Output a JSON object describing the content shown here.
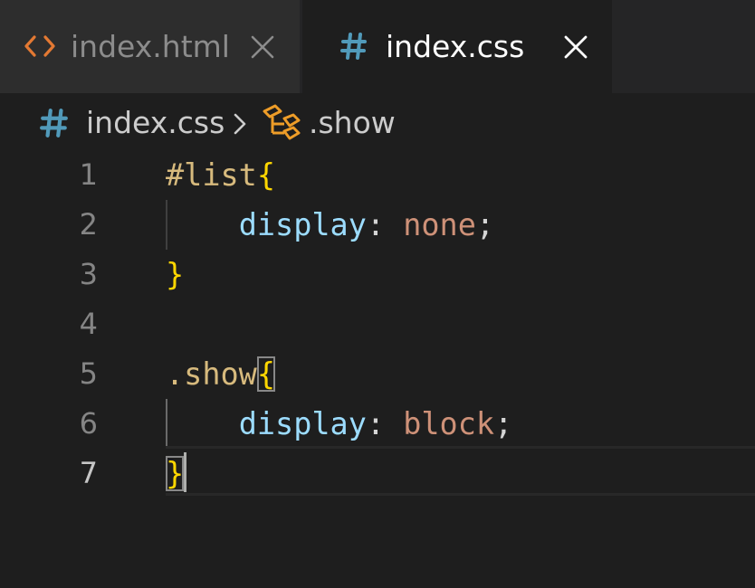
{
  "tabs": [
    {
      "label": "index.html",
      "icon": "html-code-icon",
      "active": false
    },
    {
      "label": "index.css",
      "icon": "css-hash-icon",
      "active": true
    }
  ],
  "breadcrumb": {
    "file": "index.css",
    "symbol": ".show"
  },
  "editor": {
    "current_line": 7,
    "lines": [
      {
        "number": "1",
        "tokens": {
          "selector": "#list",
          "open": "{"
        }
      },
      {
        "number": "2",
        "tokens": {
          "indent": "    ",
          "property": "display",
          "colon": ": ",
          "value": "none",
          "semi": ";"
        }
      },
      {
        "number": "3",
        "tokens": {
          "close": "}"
        }
      },
      {
        "number": "4",
        "tokens": {}
      },
      {
        "number": "5",
        "tokens": {
          "selector": ".show",
          "open": "{"
        }
      },
      {
        "number": "6",
        "tokens": {
          "indent": "    ",
          "property": "display",
          "colon": ": ",
          "value": "block",
          "semi": ";"
        }
      },
      {
        "number": "7",
        "tokens": {
          "close": "}"
        }
      }
    ]
  },
  "colors": {
    "background": "#1e1e1e",
    "tabbar": "#252526",
    "inactive_tab": "#2d2d2d",
    "html_icon": "#e37933",
    "css_icon": "#519aba",
    "symbol_icon": "#ee9d28",
    "selector": "#d7ba7d",
    "brace": "#ffd700",
    "property": "#9cdcfe",
    "value": "#ce9178"
  }
}
